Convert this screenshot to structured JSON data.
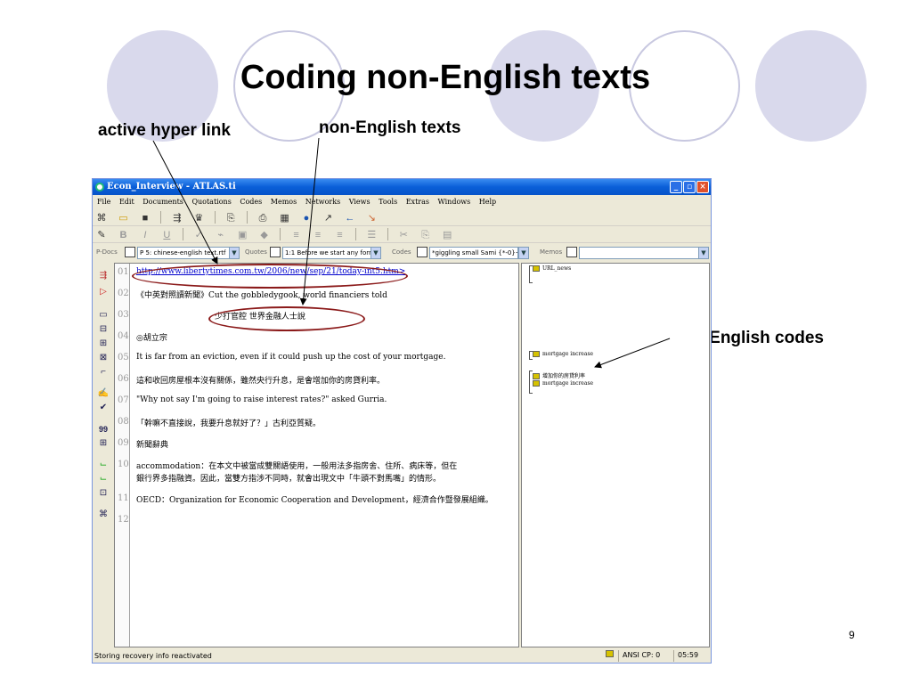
{
  "slide": {
    "title": "Coding non-English texts",
    "number": "9",
    "callouts": {
      "hyperlink": "active hyper link",
      "texts": "non-English texts",
      "codes": "non-English codes"
    },
    "colors": {
      "circle_fill": "#d9d9ec",
      "ellipse": "#8b1a1a"
    }
  },
  "window": {
    "title": "Econ_Interview - ATLAS.ti",
    "menu": [
      "File",
      "Edit",
      "Documents",
      "Quotations",
      "Codes",
      "Memos",
      "Networks",
      "Views",
      "Tools",
      "Extras",
      "Windows",
      "Help"
    ],
    "selectors": {
      "pdocs_label": "P-Docs",
      "pdocs_value": "P 5: chinese-english text.rtf",
      "quotes_label": "Quotes",
      "quotes_value": "1:1 Before we start any form",
      "codes_label": "Codes",
      "codes_value": "*giggling small Sami {*-0}~",
      "memos_label": "Memos",
      "memos_value": ""
    },
    "document_lines": [
      {
        "num": "01",
        "text": "http://www.libertytimes.com.tw/2006/new/sep/21/today-int5.htm>"
      },
      {
        "num": "02",
        "text": "《中英對照讀新聞》Cut the gobbledygook, world financiers told"
      },
      {
        "num": "03",
        "text": "少打官腔 世界金融人士說"
      },
      {
        "num": "04",
        "text": "◎胡立宗"
      },
      {
        "num": "05",
        "text": "It is far from an eviction, even if it could push up the cost of your mortgage."
      },
      {
        "num": "06",
        "text": "這和收回房屋根本沒有關係，雖然央行升息，是會增加你的房貸利率。"
      },
      {
        "num": "07",
        "text": "\"Why not say I'm going to raise interest rates?\" asked Gurria."
      },
      {
        "num": "08",
        "text": "「幹嘛不直接說，我要升息就好了？」古利亞質疑。"
      },
      {
        "num": "09",
        "text": "新聞辭典"
      },
      {
        "num": "10",
        "text": "accommodation：在本文中被當成雙關語使用，一般用法多指房舍、住所、病床等，但在"
      },
      {
        "num": "",
        "text": "銀行界多指融資。因此，當雙方指涉不同時，就會出現文中「牛頭不對馬嘴」的情形。"
      },
      {
        "num": "11",
        "text": "OECD：Organization for Economic Cooperation and Development，經濟合作暨發展組織。"
      },
      {
        "num": "12",
        "text": ""
      }
    ],
    "codes": [
      "URL_news",
      "mortgage increase",
      "增加你的房貸利率",
      "mortgage increase"
    ],
    "status": {
      "message": "Storing recovery info reactivated",
      "encoding": "ANSI CP: 0",
      "time": "05:59"
    }
  }
}
